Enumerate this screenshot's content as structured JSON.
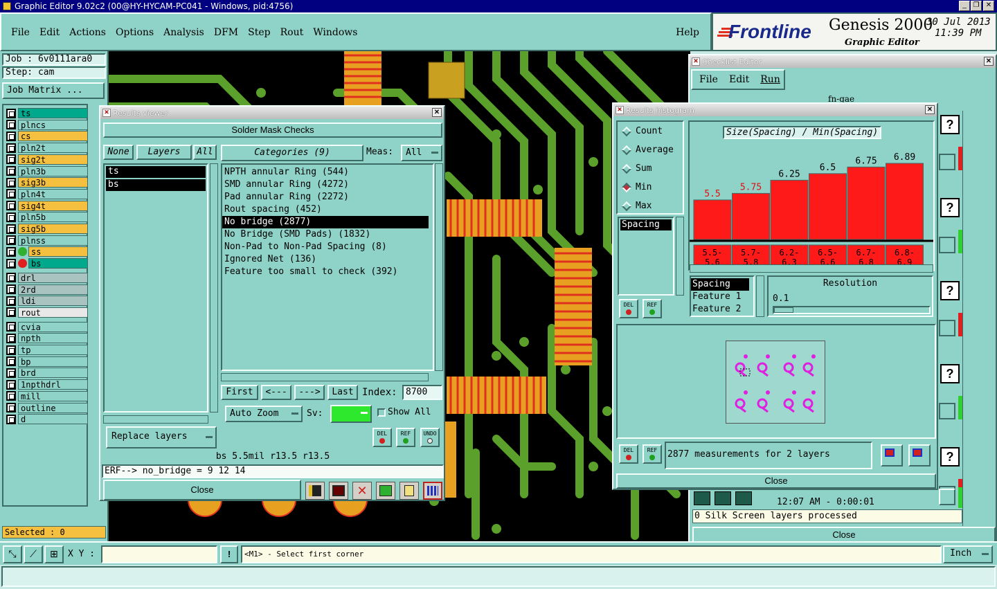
{
  "window": {
    "title": "Graphic Editor 9.02c2 (00@HY-HYCAM-PC041 - Windows, pid:4756)"
  },
  "menu": {
    "items": [
      "File",
      "Edit",
      "Actions",
      "Options",
      "Analysis",
      "DFM",
      "Step",
      "Rout",
      "Windows"
    ],
    "help": "Help"
  },
  "brand": {
    "logo": "Frontline",
    "product": "Genesis 2000",
    "subtitle": "Graphic Editor",
    "date": "30 Jul 2013",
    "time": "11:39 PM"
  },
  "job": {
    "job": "Job : 6v0111ara0",
    "step": "Step: cam",
    "matrix_button": "Job Matrix ..."
  },
  "layers": [
    {
      "name": "ts",
      "color": "#00a88c"
    },
    {
      "name": "plncs",
      "color": "#8fd2c8"
    },
    {
      "name": "cs",
      "color": "#f5c040"
    },
    {
      "name": "pln2t",
      "color": "#8fd2c8"
    },
    {
      "name": "sig2t",
      "color": "#f5c040"
    },
    {
      "name": "pln3b",
      "color": "#8fd2c8"
    },
    {
      "name": "sig3b",
      "color": "#f5c040"
    },
    {
      "name": "pln4t",
      "color": "#8fd2c8"
    },
    {
      "name": "sig4t",
      "color": "#f5c040"
    },
    {
      "name": "pln5b",
      "color": "#8fd2c8"
    },
    {
      "name": "sig5b",
      "color": "#f5c040"
    },
    {
      "name": "plnss",
      "color": "#8fd2c8"
    },
    {
      "name": "ss",
      "color": "#f5c040"
    },
    {
      "name": "bs",
      "color": "#00a88c"
    },
    {
      "name": "drl",
      "color": "#a9c3c0"
    },
    {
      "name": "2rd",
      "color": "#a9c3c0"
    },
    {
      "name": "ldi",
      "color": "#a9c3c0"
    },
    {
      "name": "rout",
      "color": "#e8e8e8"
    },
    {
      "name": "cvia",
      "color": "#8fd2c8"
    },
    {
      "name": "npth",
      "color": "#8fd2c8"
    },
    {
      "name": "tp",
      "color": "#8fd2c8"
    },
    {
      "name": "bp",
      "color": "#8fd2c8"
    },
    {
      "name": "brd",
      "color": "#8fd2c8"
    },
    {
      "name": "1npthdrl",
      "color": "#8fd2c8"
    },
    {
      "name": "mill",
      "color": "#8fd2c8"
    },
    {
      "name": "outline",
      "color": "#8fd2c8"
    },
    {
      "name": "d",
      "color": "#8fd2c8"
    }
  ],
  "selected": "Selected : 0",
  "results_viewer": {
    "title": "Results viewer",
    "header": "Solder Mask Checks",
    "btn_none": "None",
    "btn_layers": "Layers",
    "btn_all": "All",
    "layer_list": [
      "ts",
      "bs"
    ],
    "categories_label": "Categories (9)",
    "meas_label": "Meas:",
    "meas_value": "All",
    "categories": [
      "NPTH annular Ring (544)",
      "SMD annular Ring (4272)",
      "Pad annular Ring (2272)",
      "Rout spacing (452)",
      "No bridge (2877)",
      "No Bridge (SMD Pads) (1832)",
      "Non-Pad to Non-Pad Spacing (8)",
      "Ignored Net (136)",
      "Feature too small to check (392)"
    ],
    "selected_category": "No bridge (2877)",
    "nav": {
      "first": "First",
      "prev": "<---",
      "next": "--->",
      "last": "Last",
      "index_label": "Index:",
      "index_value": "8700"
    },
    "auto_zoom": "Auto Zoom",
    "sv_label": "Sv:",
    "show_all": "Show All",
    "replace_layers": "Replace layers",
    "icon_del": "DEL",
    "icon_ref": "REF",
    "icon_undo": "UNDO",
    "status": "bs 5.5mil  r13.5  r13.5",
    "erf": "ERF--> no_bridge = 9 12 14",
    "close": "Close"
  },
  "histogram": {
    "title": "Results histogram",
    "radios": [
      "Count",
      "Average",
      "Sum",
      "Min",
      "Max"
    ],
    "selected_radio": "Min",
    "measure_list": [
      "Spacing"
    ],
    "chart_title": "Size(Spacing) / Min(Spacing)",
    "bins": [
      "5.5-5.6",
      "5.7-5.8",
      "6.2-6.3",
      "6.5-6.6",
      "6.7-6.8",
      "6.8-6.9"
    ],
    "values": [
      5.5,
      5.75,
      6.25,
      6.5,
      6.75,
      6.89
    ],
    "value_labels": [
      "5.5",
      "5.75",
      "6.25",
      "6.5",
      "6.75",
      "6.89"
    ],
    "feature_list": [
      "Spacing",
      "Feature 1",
      "Feature 2"
    ],
    "resolution_label": "Resolution",
    "resolution_value": "0.1",
    "measurements": "2877 measurements for 2 layers",
    "close": "Close",
    "del": "DEL",
    "ref": "REF"
  },
  "checklist": {
    "title": "Checklist Editor",
    "menu": [
      "File",
      "Edit",
      "Run"
    ],
    "name": "fn-gae",
    "time": "12:07 AM - 0:00:01",
    "status": "0 Silk Screen layers processed",
    "close": "Close",
    "q": "?"
  },
  "bottom": {
    "xy_label": "X Y :",
    "prompt": "<M1> - Select first corner",
    "units": "Inch",
    "bang": "!"
  }
}
